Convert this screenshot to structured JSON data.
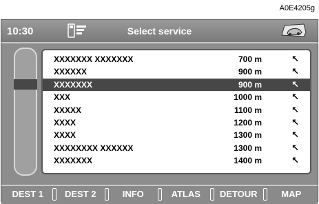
{
  "ref_code": "A0E4205g",
  "header": {
    "time": "10:30",
    "title": "Select service",
    "phone_icon": "phone-signal-icon",
    "car_icon": "car-icon"
  },
  "list": {
    "selected_index": 2,
    "items": [
      {
        "name": "XXXXXXX XXXXXXX",
        "distance": "700 m",
        "arrow": "↖"
      },
      {
        "name": "XXXXXX",
        "distance": "900 m",
        "arrow": "↖"
      },
      {
        "name": "XXXXXXX",
        "distance": "900 m",
        "arrow": "↖"
      },
      {
        "name": "XXX",
        "distance": "1000 m",
        "arrow": "↖"
      },
      {
        "name": "XXXXX",
        "distance": "1100 m",
        "arrow": "↖"
      },
      {
        "name": "XXXX",
        "distance": "1200 m",
        "arrow": "↖"
      },
      {
        "name": "XXXX",
        "distance": "1300 m",
        "arrow": "↖"
      },
      {
        "name": "XXXXXXXX XXXXXX",
        "distance": "1300 m",
        "arrow": "↖"
      },
      {
        "name": "XXXXXXX",
        "distance": "1400 m",
        "arrow": "↖"
      }
    ]
  },
  "tabs": [
    "DEST 1",
    "DEST 2",
    "INFO",
    "ATLAS",
    "DETOUR",
    "MAP"
  ]
}
